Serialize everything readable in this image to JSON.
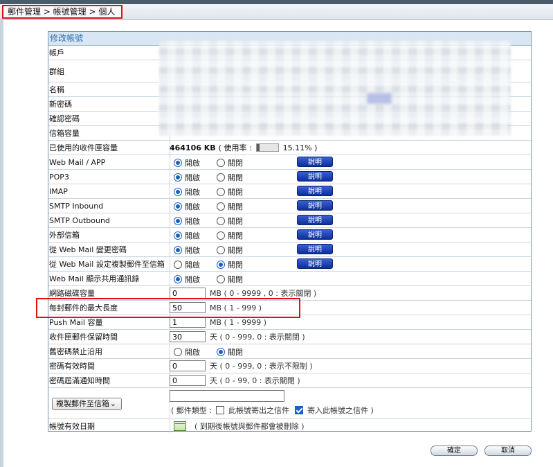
{
  "breadcrumb": "郵件管理 > 帳號管理 > 個人",
  "panel_title": "修改帳號",
  "labels": {
    "account": "帳戶",
    "group": "群組",
    "name": "名稱",
    "new_password": "新密碼",
    "confirm_password": "確認密碼",
    "mailbox_capacity": "信箱容量",
    "inbox_used": "已使用的收件匣容量",
    "webmail": "Web Mail / APP",
    "pop3": "POP3",
    "imap": "IMAP",
    "smtp_in": "SMTP Inbound",
    "smtp_out": "SMTP Outbound",
    "external": "外部信箱",
    "change_pw": "從 Web Mail 變更密碼",
    "copy_setting": "從 Web Mail 設定複製郵件至信箱",
    "shared_contacts": "Web Mail 顯示共用通訊錄",
    "netdisk": "網路磁碟容量",
    "max_length": "每封郵件的最大長度",
    "push": "Push Mail 容量",
    "retention": "收件匣郵件保留時間",
    "old_pw": "舊密碼禁止沿用",
    "pw_valid": "密碼有效時間",
    "pw_notice": "密碼屆滿通知時間",
    "expire": "帳號有效日期"
  },
  "usage": {
    "size": "464106 KB",
    "prefix": "( 使用率 :",
    "percent_text": "15.11% )",
    "percent": 15.11
  },
  "opt_on": "開啟",
  "opt_off": "關閉",
  "help": "說明",
  "toggles": {
    "webmail": "on",
    "pop3": "on",
    "imap": "on",
    "smtp_in": "on",
    "smtp_out": "on",
    "external": "on",
    "change_pw": "on",
    "copy_setting": "off",
    "shared_contacts": "on",
    "old_pw": "off"
  },
  "inputs": {
    "netdisk": "0",
    "max_length": "50",
    "push": "1",
    "retention": "30",
    "pw_valid": "0",
    "pw_notice": "0"
  },
  "hints": {
    "netdisk": "MB ( 0 - 9999 , 0 : 表示關閉 )",
    "max_length": "MB ( 1 - 999 )",
    "push": "MB ( 1 - 9999 )",
    "retention": "天 ( 0 - 999, 0 : 表示關閉 )",
    "pw_valid": "天 ( 0 - 999, 0 : 表示不限制 )",
    "pw_notice": "天 ( 0 - 99, 0 : 表示關閉 )",
    "expire": "( 到期後帳號與郵件都會被刪除 )"
  },
  "copy": {
    "select": "複製郵件至信箱",
    "type_prefix": "( 郵件類型 :",
    "outgoing": "此帳號寄出之信件",
    "incoming": "寄入此帳號之信件 )",
    "outgoing_checked": false,
    "incoming_checked": true
  },
  "buttons": {
    "confirm": "確定",
    "cancel": "取消"
  }
}
